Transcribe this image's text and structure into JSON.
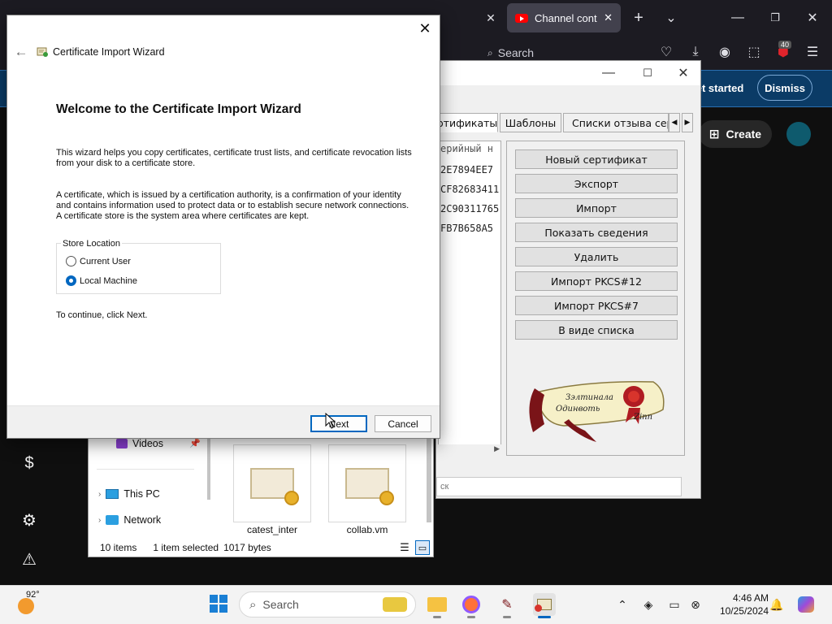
{
  "browser": {
    "active_tab_title": "Channel content",
    "search_placeholder": "Search",
    "notification_badge": "40",
    "get_started_label": "et started",
    "dismiss_label": "Dismiss",
    "create_label": "Create"
  },
  "cert_manager": {
    "tabs": [
      "ртификаты",
      "Шаблоны",
      "Списки отзыва сертис"
    ],
    "list_header": "ерийный н",
    "list_rows": [
      "2E7894EE7",
      "CF82683411",
      "2C90311765",
      "FB7B658A5"
    ],
    "buttons": [
      "Новый сертификат",
      "Экспорт",
      "Импорт",
      "Показать сведения",
      "Удалить",
      "Импорт PKCS#12",
      "Импорт PKCS#7",
      "В виде списка"
    ],
    "scroll_text_1": "Зэлтинала",
    "scroll_text_2": "Одинвоть",
    "scroll_text_3": "Zinn",
    "search_stub": "ск"
  },
  "explorer": {
    "nav_videos": "Videos",
    "nav_this_pc": "This PC",
    "nav_network": "Network",
    "files": [
      "catest_inter",
      "collab.vm"
    ],
    "status_items": "10 items",
    "status_selected": "1 item selected",
    "status_size": "1017 bytes"
  },
  "wizard": {
    "window_title": "Certificate Import Wizard",
    "heading": "Welcome to the Certificate Import Wizard",
    "para1": "This wizard helps you copy certificates, certificate trust lists, and certificate revocation lists from your disk to a certificate store.",
    "para2": "A certificate, which is issued by a certification authority, is a confirmation of your identity and contains information used to protect data or to establish secure network connections. A certificate store is the system area where certificates are kept.",
    "store_location_label": "Store Location",
    "option_current_user": "Current User",
    "option_local_machine": "Local Machine",
    "selected_option": "Local Machine",
    "continue_text": "To continue, click Next.",
    "next_label": "Next",
    "cancel_label": "Cancel"
  },
  "taskbar": {
    "temperature": "92°",
    "search_placeholder": "Search",
    "time": "4:46 AM",
    "date": "10/25/2024"
  },
  "colors": {
    "accent": "#0067c0",
    "taskbar_bg": "#f3f3f3",
    "youtube_red": "#ff0000"
  }
}
